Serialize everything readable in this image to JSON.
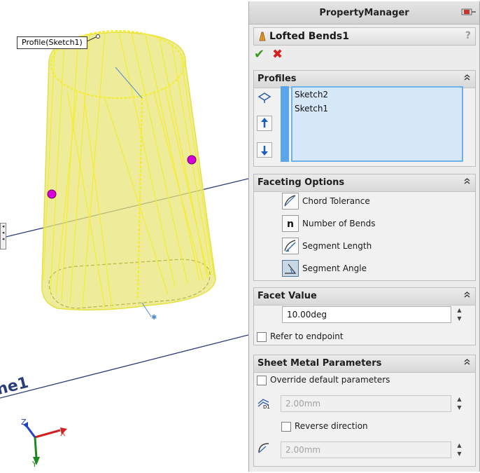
{
  "viewport": {
    "tooltip": "Profile(Sketch1)",
    "plane_label": "ne1",
    "triad": {
      "x": "X",
      "y": "Y",
      "z": "Z"
    }
  },
  "pm": {
    "title": "PropertyManager",
    "feature_name": "Lofted Bends1",
    "help": "?",
    "ok": "✔",
    "cancel": "✖",
    "profiles": {
      "title": "Profiles",
      "items": [
        "Sketch2",
        "Sketch1"
      ]
    },
    "faceting": {
      "title": "Faceting Options",
      "options": [
        "Chord Tolerance",
        "Number of Bends",
        "Segment Length",
        "Segment Angle"
      ],
      "selected": "Segment Angle"
    },
    "facet_value": {
      "title": "Facet Value",
      "value": "10.00deg",
      "refer_label": "Refer to endpoint"
    },
    "sheet_metal": {
      "title": "Sheet Metal Parameters",
      "override_label": "Override default parameters",
      "thickness": "2.00mm",
      "reverse_label": "Reverse direction",
      "radius": "2.00mm"
    }
  },
  "colors": {
    "accent": "#5aa6ea",
    "model_fill": "#e8e67a",
    "model_edge": "#f2ee2a",
    "point": "#d800d8"
  }
}
